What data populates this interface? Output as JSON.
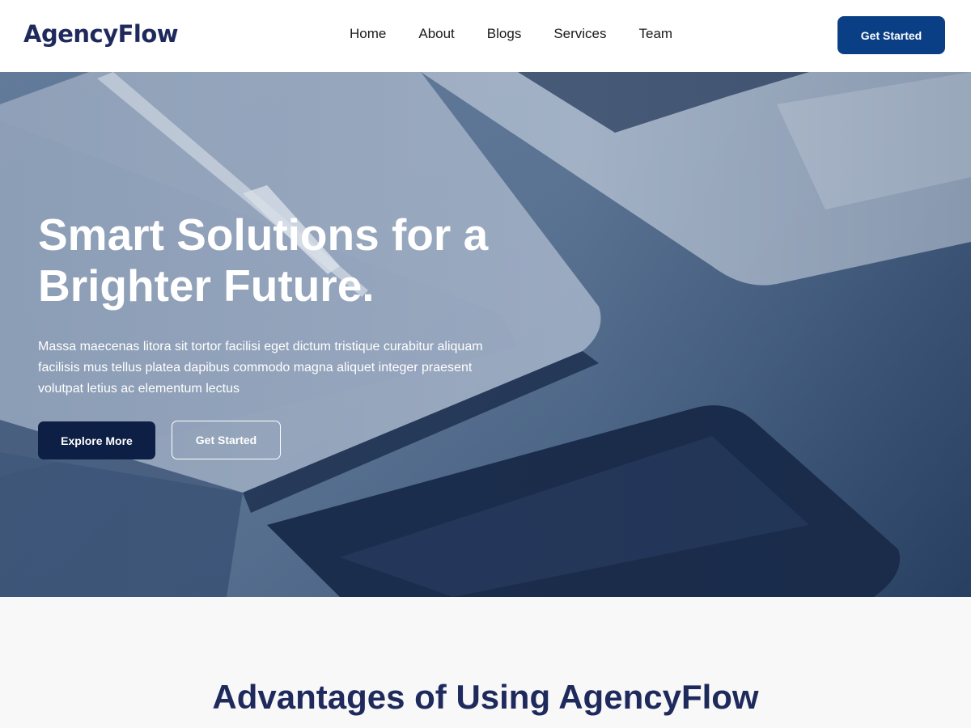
{
  "header": {
    "logo": "AgencyFlow",
    "nav": [
      "Home",
      "About",
      "Blogs",
      "Services",
      "Team"
    ],
    "cta_label": "Get Started"
  },
  "hero": {
    "title": "Smart Solutions for a Brighter Future.",
    "text": "Massa maecenas litora sit tortor facilisi eget dictum tristique curabitur aliquam facilisis mus tellus platea dapibus commodo magna aliquet integer praesent volutpat letius ac elementum lectus",
    "primary_label": "Explore More",
    "secondary_label": "Get Started"
  },
  "advantages": {
    "title": "Advantages of Using AgencyFlow"
  },
  "colors": {
    "brand_dark": "#1f2a5c",
    "button_blue": "#0b3f85",
    "button_navy": "#0d1f45",
    "section_bg": "#f8f8f9"
  }
}
